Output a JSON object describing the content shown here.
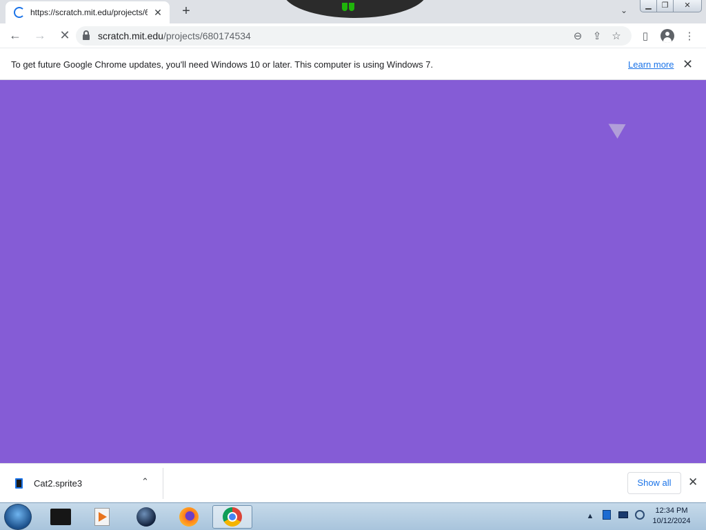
{
  "browser": {
    "tab": {
      "title": "https://scratch.mit.edu/projects/6",
      "close_glyph": "✕"
    },
    "new_tab_glyph": "+",
    "tab_search_glyph": "⌄",
    "window_controls": {
      "minimize": "▁",
      "maximize": "❐",
      "close": "✕"
    },
    "toolbar": {
      "back_glyph": "←",
      "forward_glyph": "→",
      "stop_glyph": "✕",
      "url_host": "scratch.mit.edu",
      "url_path": "/projects/680174534",
      "zoom_glyph": "⊖",
      "share_glyph": "⇪",
      "bookmark_glyph": "☆",
      "sidepanel_glyph": "▯",
      "menu_glyph": "⋮"
    },
    "infobar": {
      "message": "To get future Google Chrome updates, you'll need Windows 10 or later. This computer is using Windows 7.",
      "learn_more": "Learn more",
      "close_glyph": "✕"
    }
  },
  "page": {
    "background_color": "#855cd6"
  },
  "downloads": {
    "items": [
      {
        "name": "Cat2.sprite3",
        "icon": "file-icon",
        "chevron_glyph": "⌃"
      }
    ],
    "show_all": "Show all",
    "close_glyph": "✕"
  },
  "taskbar": {
    "apps": [
      {
        "name": "black-window-app",
        "icon": "black-window-icon"
      },
      {
        "name": "media-player-app",
        "icon": "media-player-icon"
      },
      {
        "name": "globe-app",
        "icon": "globe-icon"
      },
      {
        "name": "firefox-app",
        "icon": "firefox-icon"
      },
      {
        "name": "chrome-app",
        "icon": "chrome-icon",
        "active": true
      }
    ],
    "tray": {
      "chevron_glyph": "▲"
    },
    "clock": {
      "time": "12:34 PM",
      "date": "10/12/2024"
    }
  },
  "colors": {
    "accent": "#1a73e8",
    "scratch_purple": "#855cd6"
  }
}
